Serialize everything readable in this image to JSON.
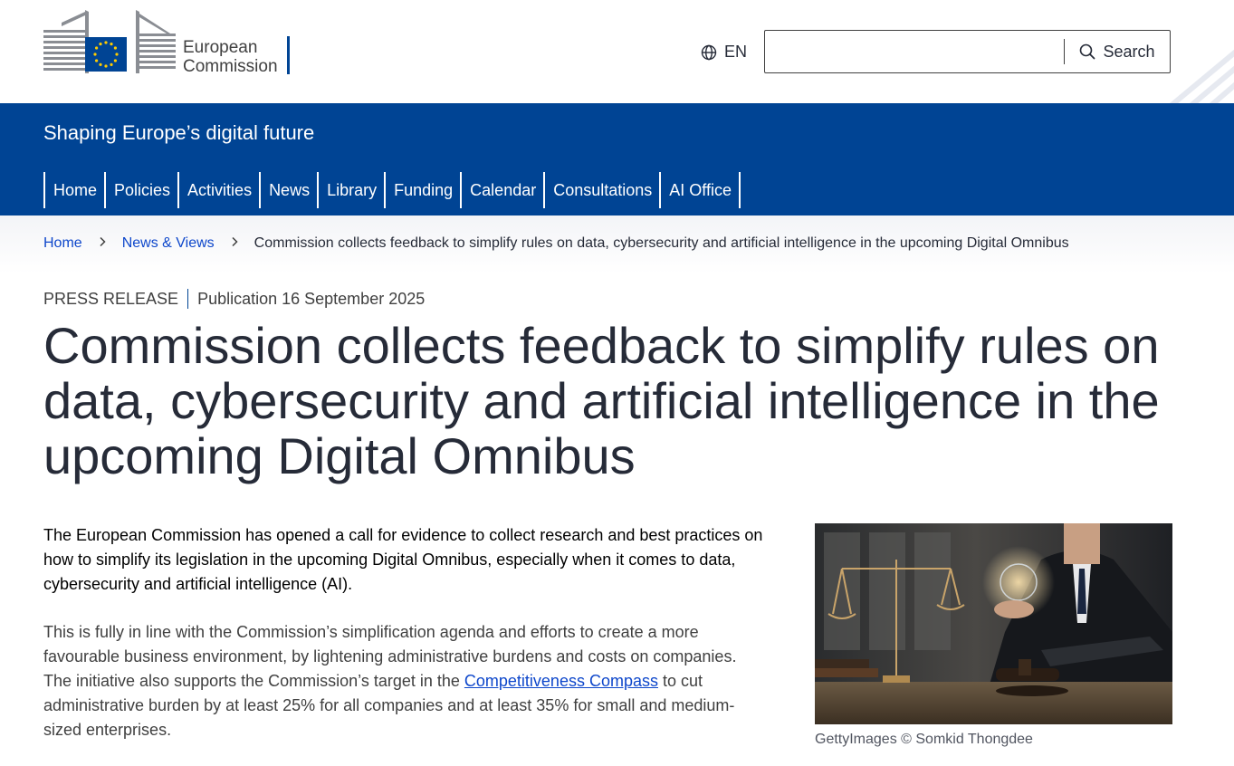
{
  "header": {
    "logo_text_line1": "European",
    "logo_text_line2": "Commission",
    "language": "EN",
    "search_placeholder": "",
    "search_button": "Search"
  },
  "site": {
    "name": "Shaping Europe’s digital future"
  },
  "nav": {
    "items": [
      "Home",
      "Policies",
      "Activities",
      "News",
      "Library",
      "Funding",
      "Calendar",
      "Consultations",
      "AI Office"
    ]
  },
  "breadcrumb": {
    "home": "Home",
    "section": "News & Views",
    "current": "Commission collects feedback to simplify rules on data, cybersecurity and artificial intelligence in the upcoming Digital Omnibus"
  },
  "article": {
    "type": "PRESS RELEASE",
    "publication": "Publication 16 September 2025",
    "title": "Commission collects feedback to simplify rules on data, cybersecurity and artificial intelligence in the upcoming Digital Omnibus",
    "paragraph1": "The European Commission has opened a call for evidence to collect research and best practices on how to simplify its legislation in the upcoming Digital Omnibus, especially when it comes to data, cybersecurity and artificial intelligence (AI).",
    "paragraph2_before": "This is fully in line with the Commission’s simplification agenda and efforts to create a more favourable business environment, by lightening administrative burdens and costs on companies. The initiative also supports the Commission’s target in the ",
    "paragraph2_link": "Competitiveness Compass",
    "paragraph2_after": " to cut administrative burden by at least 25% for all companies and at least 35% for small and medium-sized enterprises.",
    "image_caption": "GettyImages © Somkid Thongdee"
  },
  "colors": {
    "brand_blue": "#004494",
    "link_blue": "#0e47cb",
    "eu_yellow": "#ffcc00"
  },
  "icons": {
    "language": "globe-icon",
    "search": "search-icon",
    "breadcrumb_separator": "chevron-right-icon"
  }
}
